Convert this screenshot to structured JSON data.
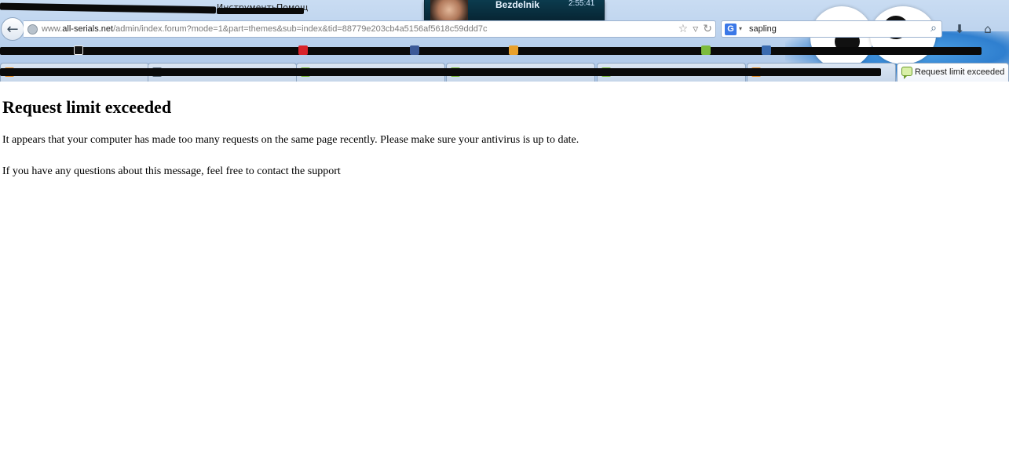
{
  "browser": {
    "menu": {
      "items": [
        "Инструменты",
        "Помощ"
      ]
    },
    "media_popup": {
      "name": "Bezdelnik",
      "time": "2:55:41"
    },
    "address": {
      "url_prefix": "www.",
      "url_host": "all-serials.net",
      "url_path": "/admin/index.forum?mode=1&part=themes&sub=index&tid=88779e203cb4a5156af5618c59ddd7c"
    },
    "search": {
      "engine_icon": "G",
      "value": "sapling"
    },
    "icons": {
      "back": "back-arrow-icon",
      "bookmark_star": "star-icon",
      "dropdown": "chevron-down-icon",
      "reload": "reload-icon",
      "download": "download-icon",
      "home": "home-icon",
      "search_go": "magnifier-icon"
    },
    "active_tab": {
      "label": "Request limit exceeded"
    },
    "colors": {
      "chrome_bg": "#b7cfec",
      "redaction": "#0a0a0a",
      "tab_favicon_green": "#7dbb3c",
      "tab_favicon_orange": "#e8912b"
    }
  },
  "page": {
    "heading": "Request limit exceeded",
    "paragraph_1": "It appears that your computer has made too many requests on the same page recently. Please make sure your antivirus is up to date.",
    "paragraph_2": "If you have any questions about this message, feel free to contact the support"
  }
}
